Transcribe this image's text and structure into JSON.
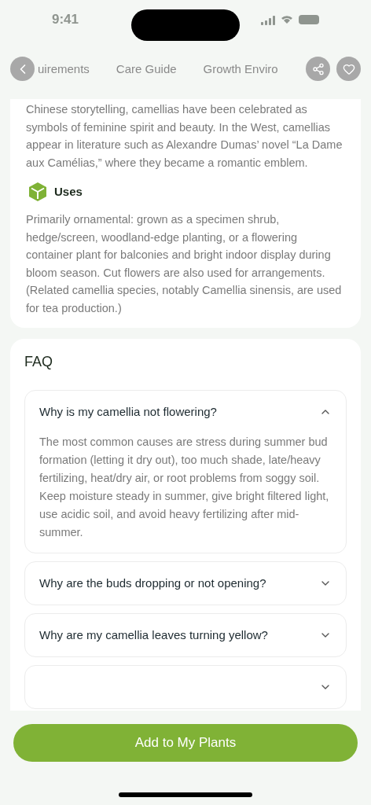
{
  "status_bar": {
    "time": "9:41"
  },
  "tabs": [
    "uirements",
    "Care Guide",
    "Growth Enviro"
  ],
  "intro_text": "Chinese storytelling, camellias have been celebrated as symbols of feminine spirit and beauty. In the West, camellias appear in literature such as Alexandre Dumas’ novel “La Dame aux Camélias,” where they became a romantic emblem.",
  "uses": {
    "title": "Uses",
    "text": "Primarily ornamental: grown as a specimen shrub, hedge/screen, woodland-edge planting, or a flowering container plant for balconies and bright indoor display during bloom season. Cut flowers are also used for arrangements. (Related camellia species, notably Camellia sinensis, are used for tea production.)"
  },
  "faq": {
    "title": "FAQ",
    "items": [
      {
        "question": "Why is my camellia not flowering?",
        "expanded": true,
        "answer": "The most common causes are stress during summer bud formation (letting it dry out), too much shade, late/heavy fertilizing, heat/dry air, or root problems from soggy soil. Keep moisture steady in summer, give bright filtered light, use acidic soil, and avoid heavy fertilizing after mid-summer."
      },
      {
        "question": "Why are the buds dropping or not opening?",
        "expanded": false
      },
      {
        "question": "Why are my camellia leaves turning yellow?",
        "expanded": false
      },
      {
        "expanded": false
      }
    ]
  },
  "add_button": "Add to My Plants"
}
